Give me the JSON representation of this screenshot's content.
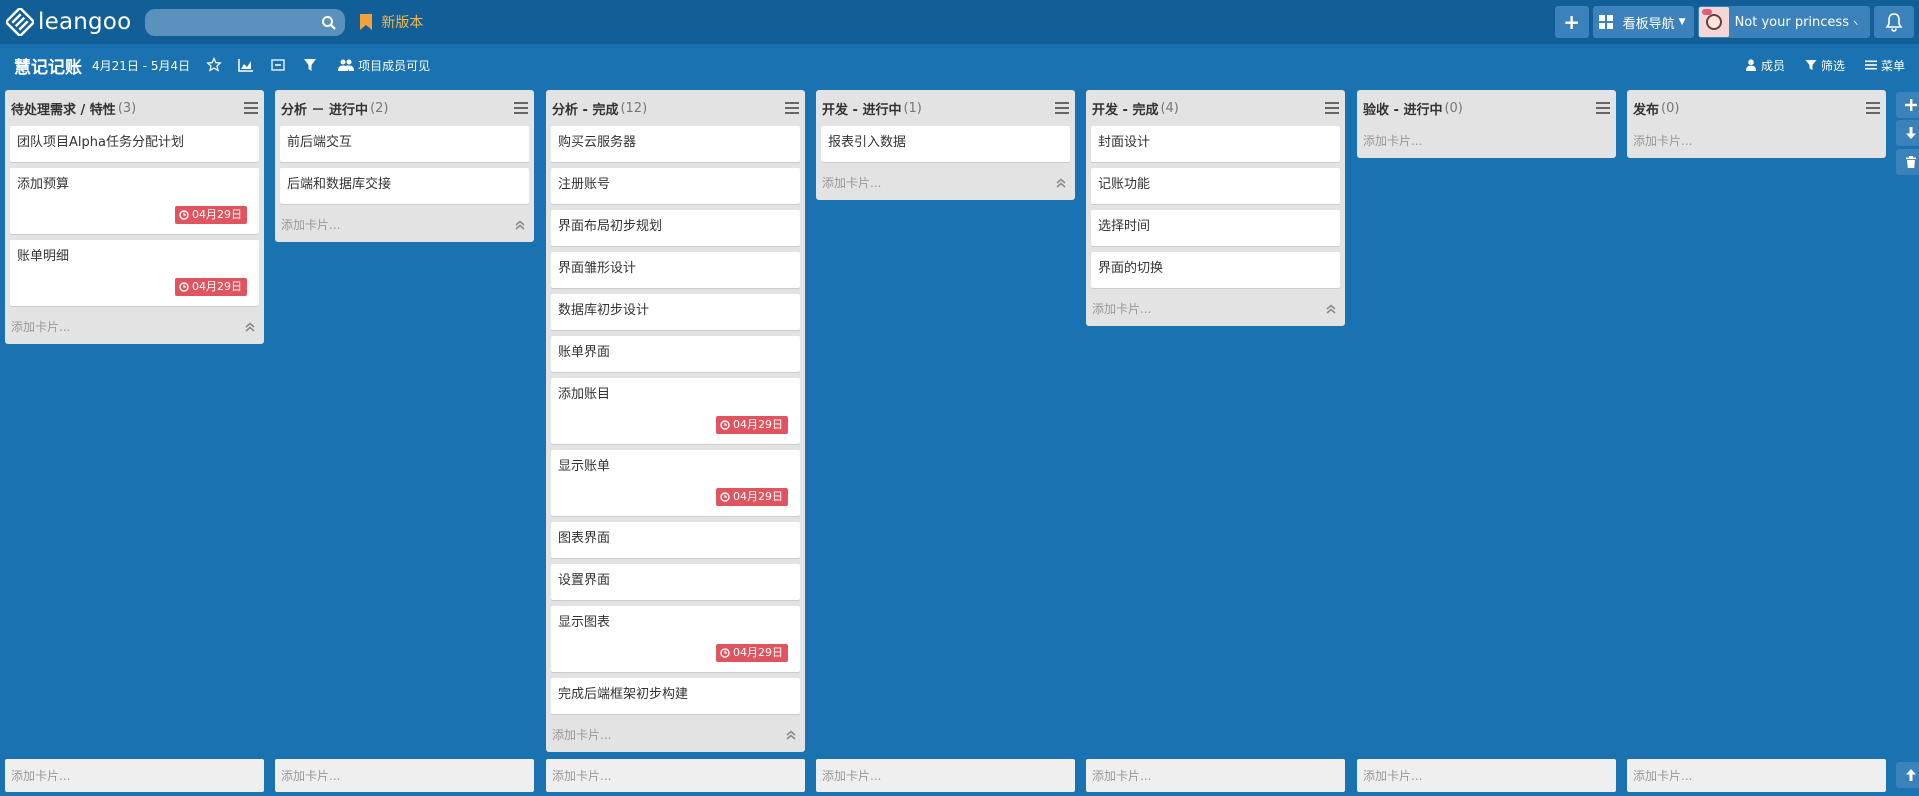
{
  "app": {
    "logo_text": "leangoo",
    "new_version_label": "新版本"
  },
  "search": {
    "value": "",
    "placeholder": ""
  },
  "topbar": {
    "add_label": "+",
    "board_nav_label": "看板导航",
    "user_name": "Not your princess"
  },
  "board": {
    "title": "慧记记账",
    "date_range": "4月21日 - 5月4日",
    "visibility_label": "项目成员可见",
    "members_label": "成员",
    "filter_label": "筛选",
    "menu_label": "菜单"
  },
  "add_card_label": "添加卡片...",
  "lists": [
    {
      "title": "待处理需求 / 特性",
      "count": "(3)",
      "cards": [
        {
          "text": "团队项目Alpha任务分配计划",
          "due": ""
        },
        {
          "text": "添加预算",
          "due": "04月29日"
        },
        {
          "text": "账单明细",
          "due": "04月29日"
        }
      ]
    },
    {
      "title": "分析 － 进行中",
      "count": "(2)",
      "cards": [
        {
          "text": "前后端交互",
          "due": ""
        },
        {
          "text": "后端和数据库交接",
          "due": ""
        }
      ]
    },
    {
      "title": "分析 - 完成",
      "count": "(12)",
      "cards": [
        {
          "text": "购买云服务器",
          "due": ""
        },
        {
          "text": "注册账号",
          "due": ""
        },
        {
          "text": "界面布局初步规划",
          "due": ""
        },
        {
          "text": "界面雏形设计",
          "due": ""
        },
        {
          "text": "数据库初步设计",
          "due": ""
        },
        {
          "text": "账单界面",
          "due": ""
        },
        {
          "text": "添加账目",
          "due": "04月29日"
        },
        {
          "text": "显示账单",
          "due": "04月29日"
        },
        {
          "text": "图表界面",
          "due": ""
        },
        {
          "text": "设置界面",
          "due": ""
        },
        {
          "text": "显示图表",
          "due": "04月29日"
        },
        {
          "text": "完成后端框架初步构建",
          "due": ""
        }
      ]
    },
    {
      "title": "开发 - 进行中",
      "count": "(1)",
      "cards": [
        {
          "text": "报表引入数据",
          "due": ""
        }
      ]
    },
    {
      "title": "开发 - 完成",
      "count": "(4)",
      "cards": [
        {
          "text": "封面设计",
          "due": ""
        },
        {
          "text": "记账功能",
          "due": ""
        },
        {
          "text": "选择时间",
          "due": ""
        },
        {
          "text": "界面的切换",
          "due": ""
        }
      ]
    },
    {
      "title": "验收 - 进行中",
      "count": "(0)",
      "cards": []
    },
    {
      "title": "发布",
      "count": "(0)",
      "cards": []
    }
  ]
}
